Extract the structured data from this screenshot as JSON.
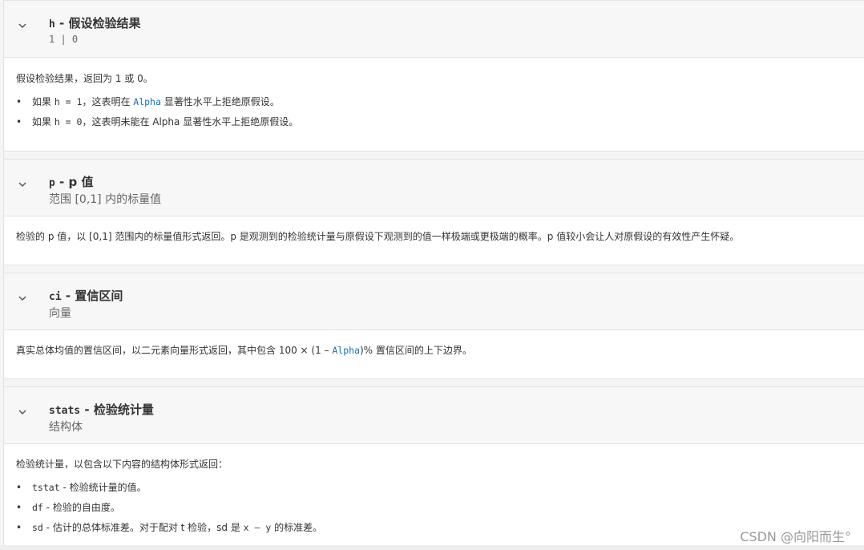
{
  "sections": [
    {
      "name_code": "h",
      "name_sep": " - ",
      "name_text": "假设检验结果",
      "subtitle": "1 | 0",
      "description": "假设检验结果，返回为 1 或 0。",
      "bullets": [
        {
          "prefix": "如果 ",
          "code": "h = 1",
          "mid": "，这表明在 ",
          "link": "Alpha",
          "suffix": " 显著性水平上拒绝原假设。"
        },
        {
          "prefix": "如果 ",
          "code": "h = 0",
          "mid": "，这表明未能在 Alpha 显著性水平上拒绝原假设。",
          "link": "",
          "suffix": ""
        }
      ]
    },
    {
      "name_code": "p",
      "name_sep": " - ",
      "name_text": "p 值",
      "subtitle": "范围 [0,1] 内的标量值",
      "description": "检验的 p 值，以 [0,1] 范围内的标量值形式返回。p 是观测到的检验统计量与原假设下观测到的值一样极端或更极端的概率。p 值较小会让人对原假设的有效性产生怀疑。"
    },
    {
      "name_code": "ci",
      "name_sep": " - ",
      "name_text": "置信区间",
      "subtitle": "向量",
      "description_pre": "真实总体均值的置信区间，以二元素向量形式返回，其中包含 100 × (1 – ",
      "description_link": "Alpha",
      "description_post": ")% 置信区间的上下边界。"
    },
    {
      "name_code": "stats",
      "name_sep": " - ",
      "name_text": "检验统计量",
      "subtitle": "结构体",
      "description": "检验统计量，以包含以下内容的结构体形式返回：",
      "bullets": [
        {
          "code": "tstat",
          "text": " - 检验统计量的值。"
        },
        {
          "code": "df",
          "text": " - 检验的自由度。"
        },
        {
          "code": "sd",
          "text": " - 估计的总体标准差。对于配对 t 检验，sd 是 ",
          "code2": "x – y",
          "text2": " 的标准差。"
        }
      ]
    }
  ],
  "bullet_char": "•",
  "watermark": "CSDN @向阳而生°"
}
